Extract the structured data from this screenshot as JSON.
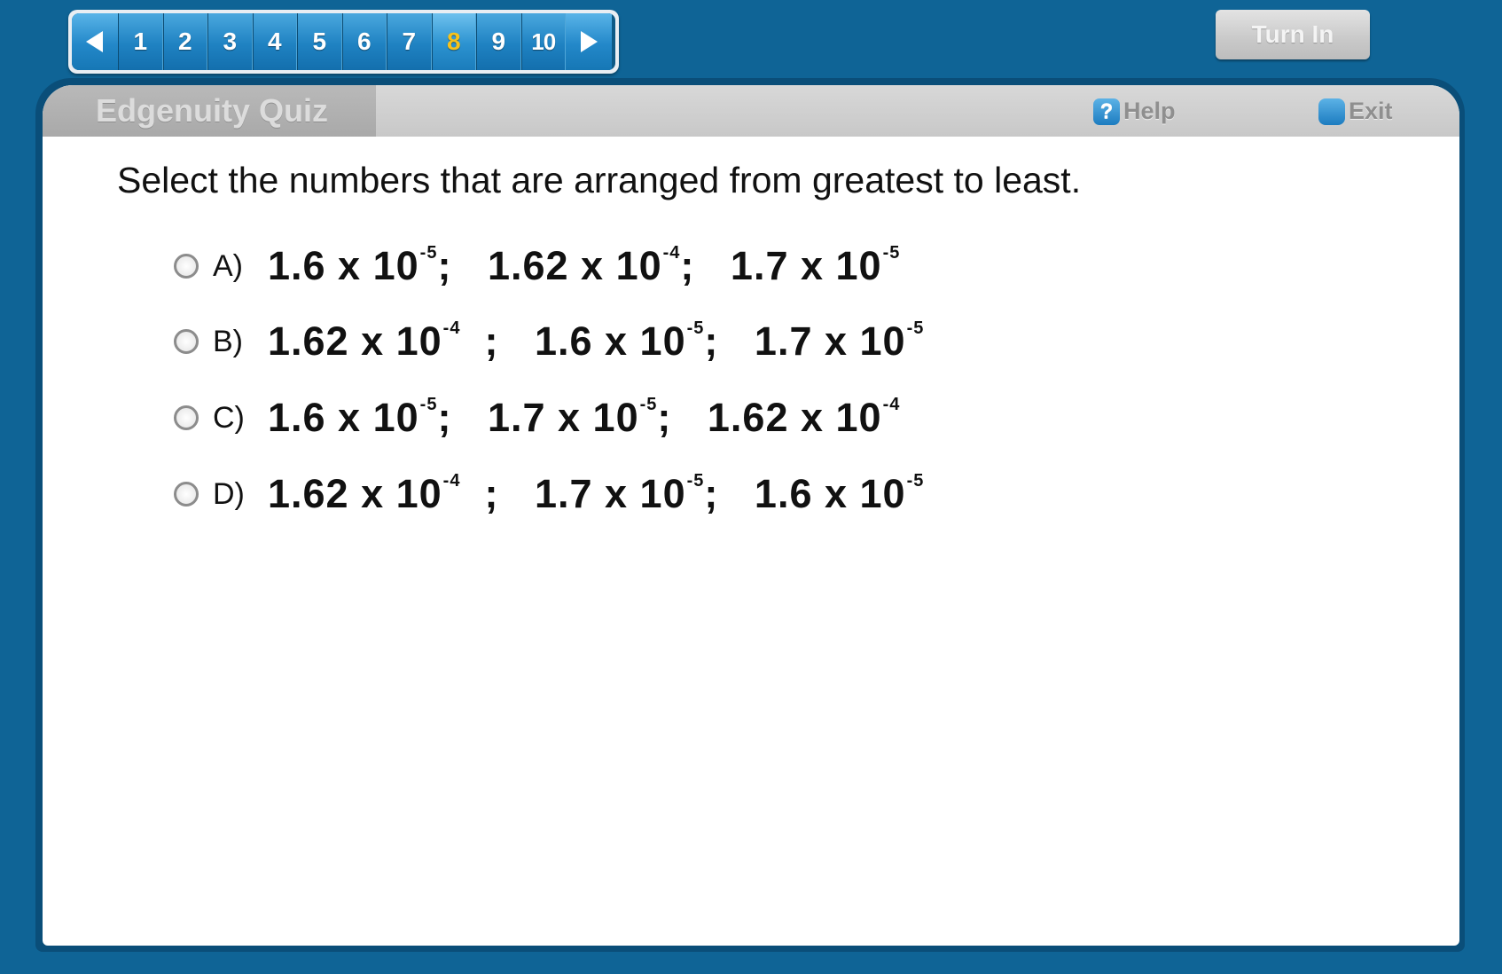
{
  "nav": {
    "prev_icon": "left-arrow-icon",
    "next_icon": "right-arrow-icon",
    "questions": [
      "1",
      "2",
      "3",
      "4",
      "5",
      "6",
      "7",
      "8",
      "9",
      "10"
    ],
    "current": "8"
  },
  "turn_in_label": "Turn In",
  "header": {
    "quiz_title": "Edgenuity Quiz",
    "help_label": "Help",
    "help_icon": "question-mark-icon",
    "exit_label": "Exit",
    "exit_icon": "exit-square-icon"
  },
  "question": "Select the numbers that are arranged from greatest to least.",
  "options": [
    {
      "letter": "A)",
      "terms": [
        {
          "coef": "1.6 x 10",
          "exp": "-5",
          "sep": ";   "
        },
        {
          "coef": "1.62 x 10",
          "exp": "-4",
          "sep": ";   "
        },
        {
          "coef": "1.7 x 10",
          "exp": "-5",
          "sep": ""
        }
      ]
    },
    {
      "letter": "B)",
      "terms": [
        {
          "coef": "1.62 x 10",
          "exp": "-4",
          "sep": "  ;   "
        },
        {
          "coef": "1.6 x 10",
          "exp": "-5",
          "sep": ";   "
        },
        {
          "coef": "1.7 x 10",
          "exp": "-5",
          "sep": ""
        }
      ]
    },
    {
      "letter": "C)",
      "terms": [
        {
          "coef": "1.6 x 10",
          "exp": "-5",
          "sep": ";   "
        },
        {
          "coef": "1.7 x 10",
          "exp": "-5",
          "sep": ";   "
        },
        {
          "coef": "1.62 x 10",
          "exp": "-4",
          "sep": ""
        }
      ]
    },
    {
      "letter": "D)",
      "terms": [
        {
          "coef": "1.62 x 10",
          "exp": "-4",
          "sep": "  ;   "
        },
        {
          "coef": "1.7 x 10",
          "exp": "-5",
          "sep": ";   "
        },
        {
          "coef": "1.6 x 10",
          "exp": "-5",
          "sep": ""
        }
      ]
    }
  ],
  "colors": {
    "background": "#0f6496",
    "nav_button": "#1f82c2",
    "current_question": "#f7c21b",
    "header_bar": "#c8c8c8"
  }
}
